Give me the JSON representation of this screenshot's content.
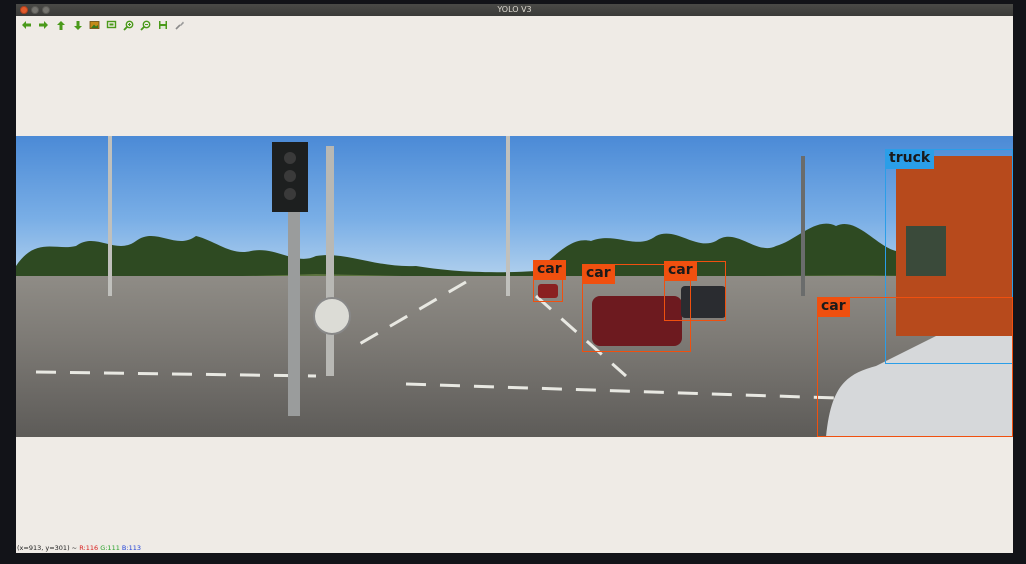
{
  "window": {
    "title": "YOLO V3"
  },
  "toolbar": {
    "buttons": [
      {
        "name": "pan-left",
        "icon": "arrow-left-icon",
        "color": "#4a9a1a"
      },
      {
        "name": "pan-right",
        "icon": "arrow-right-icon",
        "color": "#4a9a1a"
      },
      {
        "name": "pan-up",
        "icon": "arrow-up-icon",
        "color": "#4a9a1a"
      },
      {
        "name": "pan-down",
        "icon": "arrow-down-icon",
        "color": "#4a9a1a"
      },
      {
        "name": "zoom-fit",
        "icon": "image-icon",
        "color": "#8a7a1a"
      },
      {
        "name": "zoom-rect",
        "icon": "zoom-rect-icon",
        "color": "#4a9a1a"
      },
      {
        "name": "zoom-in",
        "icon": "zoom-in-icon",
        "color": "#4a9a1a"
      },
      {
        "name": "zoom-out",
        "icon": "zoom-out-icon",
        "color": "#4a9a1a"
      },
      {
        "name": "save",
        "icon": "save-icon",
        "color": "#4a9a1a"
      },
      {
        "name": "properties",
        "icon": "properties-icon",
        "color": "#8a8a8a"
      }
    ]
  },
  "detections": [
    {
      "label": "truck"
    },
    {
      "label": "car"
    },
    {
      "label": "car"
    },
    {
      "label": "car"
    },
    {
      "label": "car"
    }
  ],
  "status": {
    "coords": "(x=913, y=301) ~",
    "r": "R:116",
    "g": "G:111",
    "b": "B:113"
  }
}
